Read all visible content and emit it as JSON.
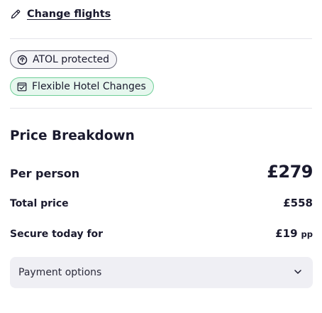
{
  "change_flights": {
    "label": "Change flights",
    "icon": "pencil-icon"
  },
  "badges": [
    {
      "label": "ATOL protected",
      "icon": "atol-icon"
    },
    {
      "label": "Flexible Hotel Changes",
      "icon": "calendar-check-icon"
    }
  ],
  "price_breakdown": {
    "title": "Price Breakdown",
    "per_person": {
      "label": "Per person",
      "value": "£279"
    },
    "total": {
      "label": "Total price",
      "value": "£558"
    },
    "secure": {
      "label": "Secure today for",
      "value": "£19",
      "unit": "pp"
    }
  },
  "payment_options": {
    "label": "Payment options",
    "icon": "chevron-down-icon"
  },
  "colors": {
    "text": "#1a1a2e",
    "badge_green_bg": "#e6f7ee",
    "badge_green_border": "#6fcf97",
    "panel_bg": "#efeff4"
  }
}
